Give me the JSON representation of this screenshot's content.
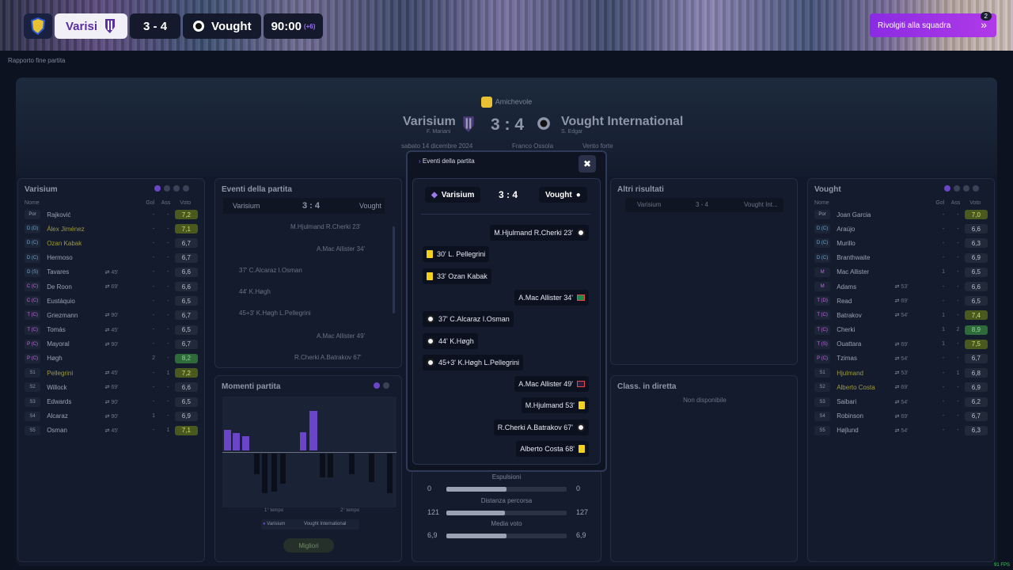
{
  "scoreboard": {
    "home": "Varisi",
    "score": "3 - 4",
    "away": "Vought",
    "time": "90:00",
    "added": "(+6)"
  },
  "top_button": {
    "label": "Rivolgiti alla squadra",
    "count": "2"
  },
  "breadcrumb": "Rapporto fine partita",
  "match": {
    "type": "Amichevole",
    "home": "Varisium",
    "home_coach": "F. Mariani",
    "score": "3 : 4",
    "away": "Vought International",
    "away_coach": "S. Edgar",
    "date": "sabato 14 dicembre 2024",
    "referee": "Franco Ossola",
    "weather": "Vento forte"
  },
  "home_card": {
    "title": "Varisium",
    "headers": [
      "Nome",
      "Gol",
      "Ass",
      "Voto"
    ],
    "rows": [
      {
        "pos": "Por",
        "name": "Rajković",
        "sub": "",
        "gol": "-",
        "ass": "-",
        "voto": "7,2",
        "cls": "g1"
      },
      {
        "pos": "D (D)",
        "name": "Álex Jiménez",
        "sub": "",
        "gol": "-",
        "ass": "-",
        "voto": "7,1",
        "cls": "g1",
        "hl": true
      },
      {
        "pos": "D (C)",
        "name": "Ozan Kabak",
        "sub": "",
        "gol": "-",
        "ass": "-",
        "voto": "6,7",
        "hl": true
      },
      {
        "pos": "D (C)",
        "name": "Hermoso",
        "sub": "",
        "gol": "-",
        "ass": "-",
        "voto": "6,7"
      },
      {
        "pos": "D (S)",
        "name": "Tavares",
        "sub": "45'",
        "gol": "-",
        "ass": "-",
        "voto": "6,6"
      },
      {
        "pos": "C (C)",
        "name": "De Roon",
        "sub": "69'",
        "gol": "-",
        "ass": "-",
        "voto": "6,6"
      },
      {
        "pos": "C (C)",
        "name": "Eustáquio",
        "sub": "",
        "gol": "-",
        "ass": "-",
        "voto": "6,5"
      },
      {
        "pos": "T (C)",
        "name": "Griezmann",
        "sub": "90'",
        "gol": "-",
        "ass": "-",
        "voto": "6,7"
      },
      {
        "pos": "T (C)",
        "name": "Tomás",
        "sub": "45'",
        "gol": "-",
        "ass": "-",
        "voto": "6,5"
      },
      {
        "pos": "P (C)",
        "name": "Mayoral",
        "sub": "90'",
        "gol": "-",
        "ass": "-",
        "voto": "6,7"
      },
      {
        "pos": "P (C)",
        "name": "Høgh",
        "sub": "",
        "gol": "2",
        "ass": "-",
        "voto": "8,2",
        "cls": "g2"
      },
      {
        "pos": "S1",
        "name": "Pellegrini",
        "sub": "45'",
        "gol": "-",
        "ass": "1",
        "voto": "7,2",
        "cls": "g1",
        "hl": true
      },
      {
        "pos": "S2",
        "name": "Willock",
        "sub": "69'",
        "gol": "-",
        "ass": "-",
        "voto": "6,6"
      },
      {
        "pos": "S3",
        "name": "Edwards",
        "sub": "90'",
        "gol": "-",
        "ass": "-",
        "voto": "6,5"
      },
      {
        "pos": "S4",
        "name": "Alcaraz",
        "sub": "90'",
        "gol": "1",
        "ass": "-",
        "voto": "6,9"
      },
      {
        "pos": "S5",
        "name": "Osman",
        "sub": "45'",
        "gol": "-",
        "ass": "1",
        "voto": "7,1",
        "cls": "g1"
      }
    ]
  },
  "away_card": {
    "title": "Vought",
    "headers": [
      "Nome",
      "Gol",
      "Ass",
      "Voto"
    ],
    "rows": [
      {
        "pos": "Por",
        "name": "Joan Garcia",
        "sub": "",
        "gol": "-",
        "ass": "-",
        "voto": "7,0",
        "cls": "g1"
      },
      {
        "pos": "D (C)",
        "name": "Araújo",
        "sub": "",
        "gol": "-",
        "ass": "-",
        "voto": "6,6"
      },
      {
        "pos": "D (C)",
        "name": "Murillo",
        "sub": "",
        "gol": "-",
        "ass": "-",
        "voto": "6,3"
      },
      {
        "pos": "D (C)",
        "name": "Branthwaite",
        "sub": "",
        "gol": "-",
        "ass": "-",
        "voto": "6,9"
      },
      {
        "pos": "M",
        "name": "Mac Allister",
        "sub": "",
        "gol": "1",
        "ass": "-",
        "voto": "6,5"
      },
      {
        "pos": "M",
        "name": "Adams",
        "sub": "53'",
        "gol": "-",
        "ass": "-",
        "voto": "6,6"
      },
      {
        "pos": "T (D)",
        "name": "Read",
        "sub": "69'",
        "gol": "-",
        "ass": "-",
        "voto": "6,5"
      },
      {
        "pos": "T (C)",
        "name": "Batrakov",
        "sub": "54'",
        "gol": "1",
        "ass": "-",
        "voto": "7,4",
        "cls": "g1"
      },
      {
        "pos": "T (C)",
        "name": "Cherki",
        "sub": "",
        "gol": "1",
        "ass": "2",
        "voto": "8,9",
        "cls": "g2"
      },
      {
        "pos": "T (S)",
        "name": "Ouattara",
        "sub": "69'",
        "gol": "1",
        "ass": "-",
        "voto": "7,5",
        "cls": "g1"
      },
      {
        "pos": "P (C)",
        "name": "Tzimas",
        "sub": "54'",
        "gol": "-",
        "ass": "-",
        "voto": "6,7"
      },
      {
        "pos": "S1",
        "name": "Hjulmand",
        "sub": "53'",
        "gol": "-",
        "ass": "1",
        "voto": "6,8",
        "hl": true
      },
      {
        "pos": "S2",
        "name": "Alberto Costa",
        "sub": "69'",
        "gol": "-",
        "ass": "-",
        "voto": "6,9",
        "hl": true
      },
      {
        "pos": "S3",
        "name": "Saibari",
        "sub": "54'",
        "gol": "-",
        "ass": "-",
        "voto": "6,2"
      },
      {
        "pos": "S4",
        "name": "Robinson",
        "sub": "69'",
        "gol": "-",
        "ass": "-",
        "voto": "6,7"
      },
      {
        "pos": "S5",
        "name": "Højlund",
        "sub": "54'",
        "gol": "-",
        "ass": "-",
        "voto": "6,3"
      }
    ]
  },
  "events_card": {
    "title": "Eventi della partita",
    "home": "Varisium",
    "score": "3 : 4",
    "away": "Vought",
    "bg_events": [
      "M.Hjulmand  R.Cherki  23'",
      "A.Mac Allister  34'",
      "37'  C.Alcaraz  I.Osman",
      "44'  K.Høgh",
      "45+3'  K.Høgh  L.Pellegrini",
      "A.Mac Allister  49'",
      "R.Cherki  A.Batrakov  67'"
    ]
  },
  "momenti": {
    "title": "Momenti partita",
    "first_half": "1° tempo",
    "second_half": "2° tempo",
    "legend_home": "Varisium",
    "legend_away": "Vought International",
    "button": "Migliori"
  },
  "other_results": {
    "title": "Altri risultati",
    "home": "Varisium",
    "score": "3 - 4",
    "away": "Vought Int..."
  },
  "live_table": {
    "title": "Class. in diretta",
    "empty": "Non disponibile"
  },
  "stats": [
    {
      "label": "Espulsioni",
      "home": "0",
      "away": "0",
      "home_frac": 0.5
    },
    {
      "label": "Distanza percorsa",
      "home": "121",
      "away": "127",
      "home_frac": 0.49
    },
    {
      "label": "Media voto",
      "home": "6,9",
      "away": "6,9",
      "home_frac": 0.5
    }
  ],
  "modal": {
    "title": "Eventi della partita",
    "close": "✖",
    "home": "Varisium",
    "score": "3 : 4",
    "away": "Vought",
    "events": [
      {
        "side": "away",
        "text": "M.Hjulmand  R.Cherki  23'",
        "icon": "ball"
      },
      {
        "side": "home",
        "text": "30'  L. Pellegrini",
        "icon": "yel"
      },
      {
        "side": "home",
        "text": "33'  Ozan Kabak",
        "icon": "yel"
      },
      {
        "side": "away",
        "text": "A.Mac Allister  34'",
        "icon": "swap"
      },
      {
        "side": "home",
        "text": "37'  C.Alcaraz  I.Osman",
        "icon": "ball"
      },
      {
        "side": "home",
        "text": "44'  K.Høgh",
        "icon": "ball"
      },
      {
        "side": "home",
        "text": "45+3'  K.Høgh  L.Pellegrini",
        "icon": "ball"
      },
      {
        "side": "away",
        "text": "A.Mac Allister  49'",
        "icon": "swap2"
      },
      {
        "side": "away",
        "text": "M.Hjulmand  53'",
        "icon": "yel"
      },
      {
        "side": "away",
        "text": "R.Cherki  A.Batrakov  67'",
        "icon": "ball"
      },
      {
        "side": "away",
        "text": "Alberto Costa  68'",
        "icon": "yel"
      }
    ]
  },
  "fps": "91 FPS",
  "colors": {
    "accent": "#8a2be2",
    "home": "#6a45c8",
    "yellow": "#f2d21e"
  }
}
